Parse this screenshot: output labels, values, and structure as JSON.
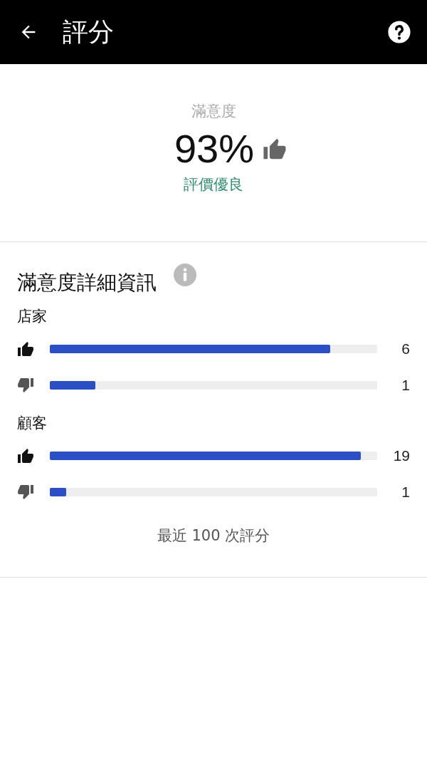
{
  "header": {
    "title": "評分"
  },
  "summary": {
    "label": "滿意度",
    "percent": "93%",
    "rating": "評價優良"
  },
  "details": {
    "title": "滿意度詳細資訊",
    "groups": [
      {
        "name": "店家",
        "rows": [
          {
            "kind": "up",
            "level": 0.857,
            "count": "6"
          },
          {
            "kind": "down",
            "level": 0.14,
            "count": "1"
          }
        ]
      },
      {
        "name": "顧客",
        "rows": [
          {
            "kind": "up",
            "level": 0.95,
            "count": "19"
          },
          {
            "kind": "down",
            "level": 0.05,
            "count": "1"
          }
        ]
      }
    ],
    "footnote": "最近 100 次評分"
  }
}
